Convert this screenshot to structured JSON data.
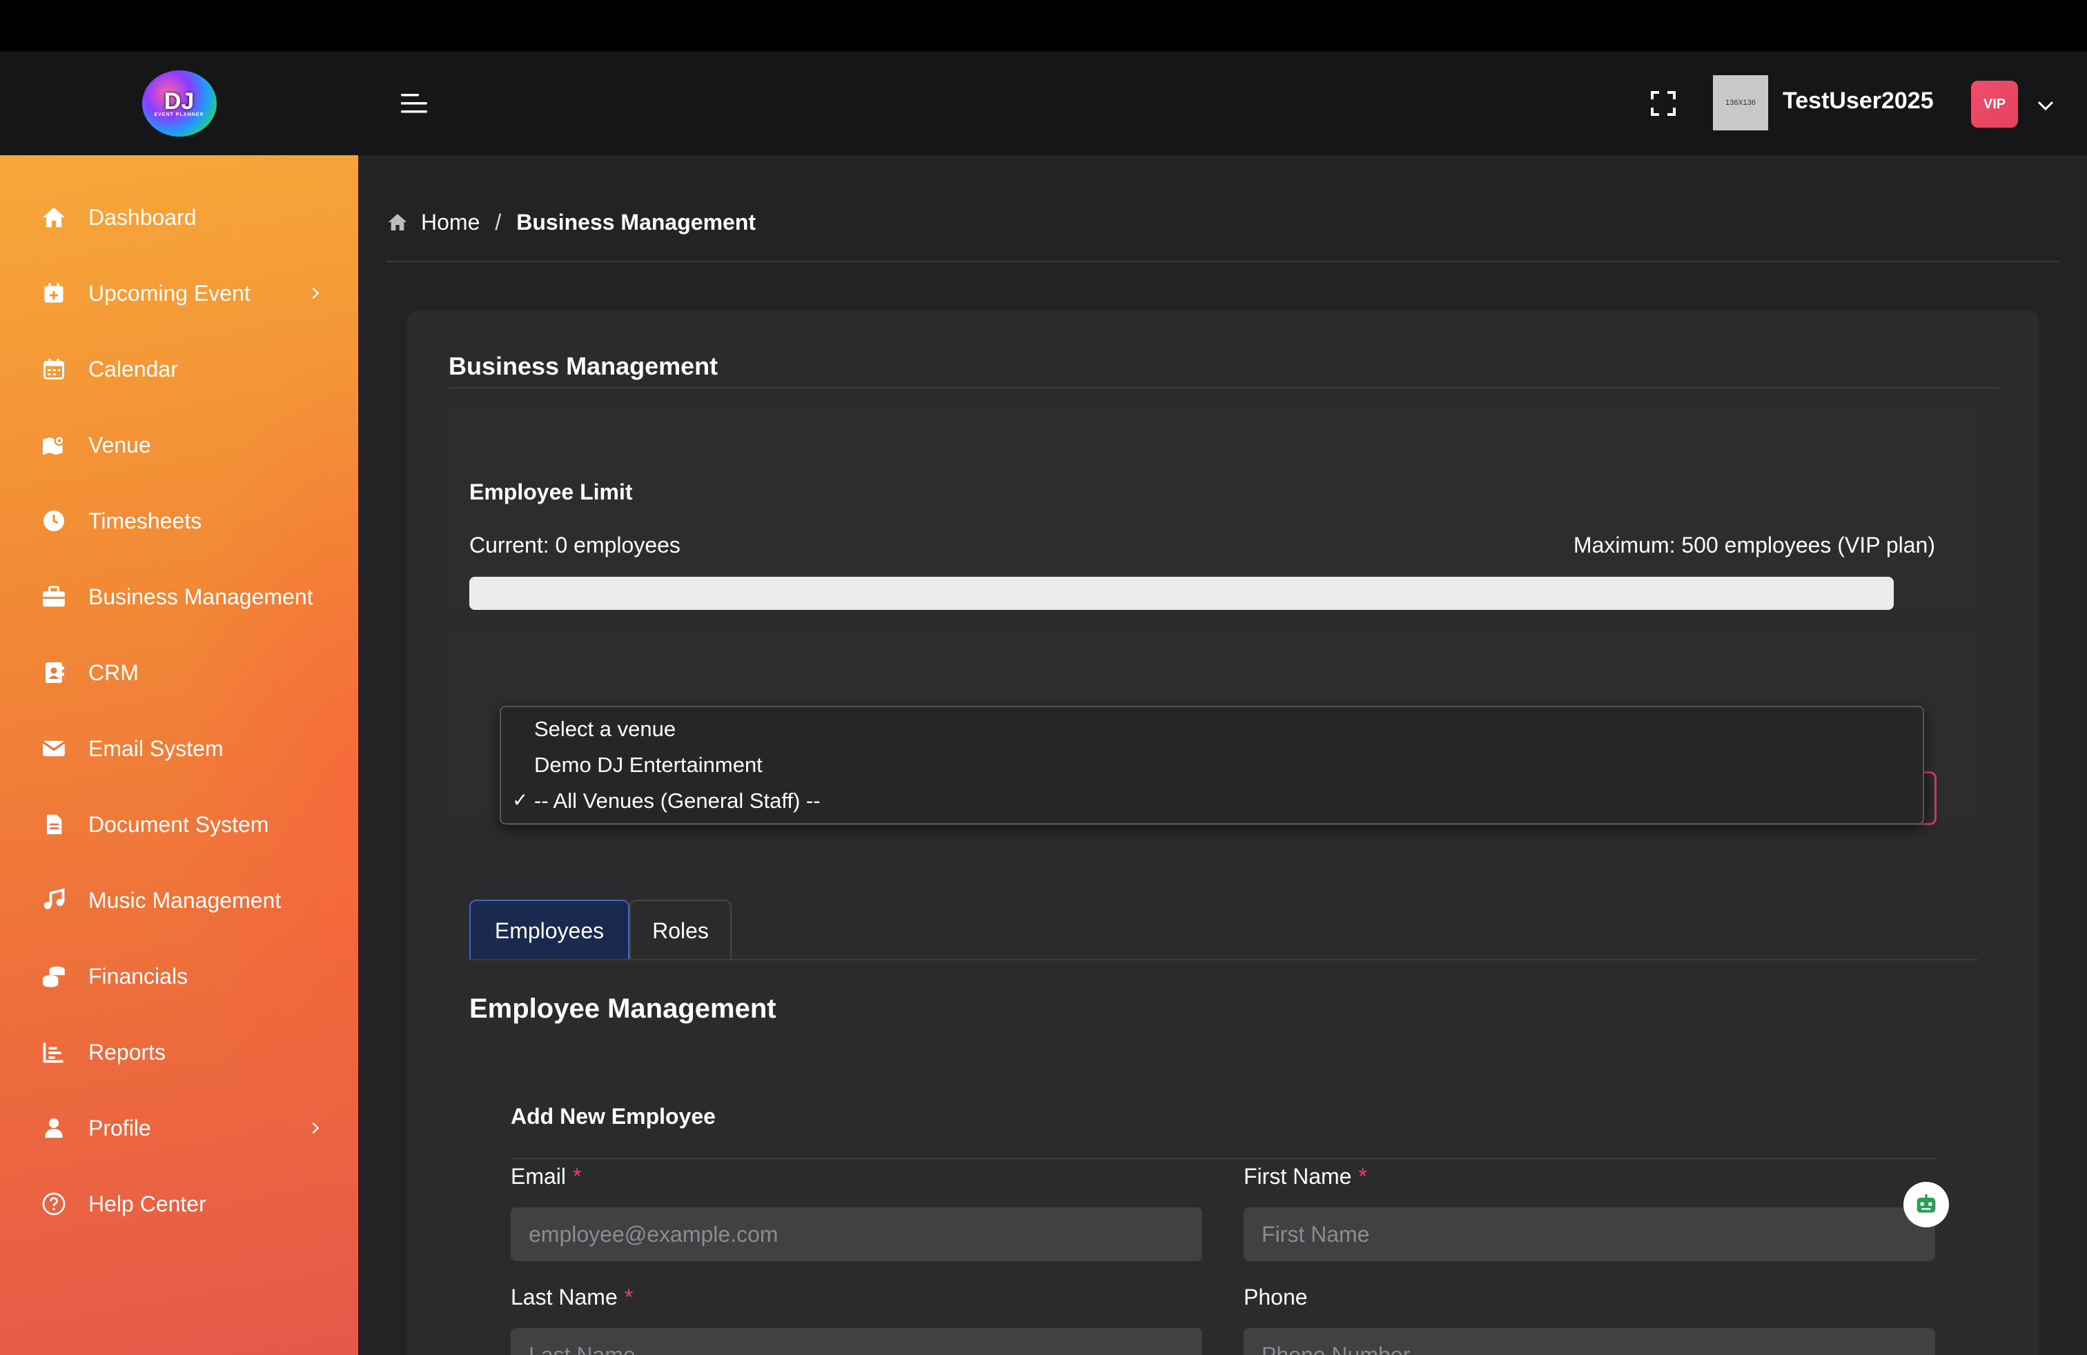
{
  "logo": {
    "text": "DJ",
    "subtext": "EVENT PLANNER"
  },
  "sidebar": {
    "items": [
      {
        "label": "Dashboard",
        "icon": "home-icon"
      },
      {
        "label": "Upcoming Event",
        "icon": "calendar-plus-icon",
        "has_submenu": true
      },
      {
        "label": "Calendar",
        "icon": "calendar-icon"
      },
      {
        "label": "Venue",
        "icon": "map-location-icon"
      },
      {
        "label": "Timesheets",
        "icon": "clock-icon"
      },
      {
        "label": "Business Management",
        "icon": "briefcase-icon"
      },
      {
        "label": "CRM",
        "icon": "contact-card-icon"
      },
      {
        "label": "Email System",
        "icon": "envelope-icon"
      },
      {
        "label": "Document System",
        "icon": "document-icon"
      },
      {
        "label": "Music Management",
        "icon": "music-note-icon"
      },
      {
        "label": "Financials",
        "icon": "coins-icon"
      },
      {
        "label": "Reports",
        "icon": "bar-chart-icon"
      },
      {
        "label": "Profile",
        "icon": "user-icon",
        "has_submenu": true
      },
      {
        "label": "Help Center",
        "icon": "question-circle-icon"
      }
    ]
  },
  "header": {
    "avatar_placeholder": "136X136",
    "username": "TestUser2025",
    "badge": "VIP"
  },
  "breadcrumb": {
    "home": "Home",
    "separator": "/",
    "current": "Business Management"
  },
  "card": {
    "title": "Business Management",
    "employee_limit": {
      "title": "Employee Limit",
      "current": "Current: 0 employees",
      "maximum": "Maximum: 500 employees (VIP plan)",
      "fill_fraction": 0
    },
    "venue_select": {
      "options": [
        "Select a venue",
        "Demo DJ Entertainment",
        "-- All Venues (General Staff) --"
      ],
      "selected": "-- All Venues (General Staff) --",
      "check": "✓"
    },
    "tabs": [
      {
        "label": "Employees",
        "active": true
      },
      {
        "label": "Roles",
        "active": false
      }
    ],
    "section_heading": "Employee Management",
    "form": {
      "title": "Add New Employee",
      "email_label": "Email",
      "email_placeholder": "employee@example.com",
      "first_name_label": "First Name",
      "first_name_placeholder": "First Name",
      "last_name_label": "Last Name",
      "last_name_placeholder": "Last Name",
      "phone_label": "Phone",
      "phone_placeholder": "Phone Number",
      "required_mark": "*"
    }
  },
  "colors": {
    "sidebar_gradient_top": "#f7a83a",
    "sidebar_gradient_bottom": "#e5584a",
    "vip_badge": "#f04e6e",
    "active_tab": "#1a2a4e",
    "required": "#e5455d"
  }
}
